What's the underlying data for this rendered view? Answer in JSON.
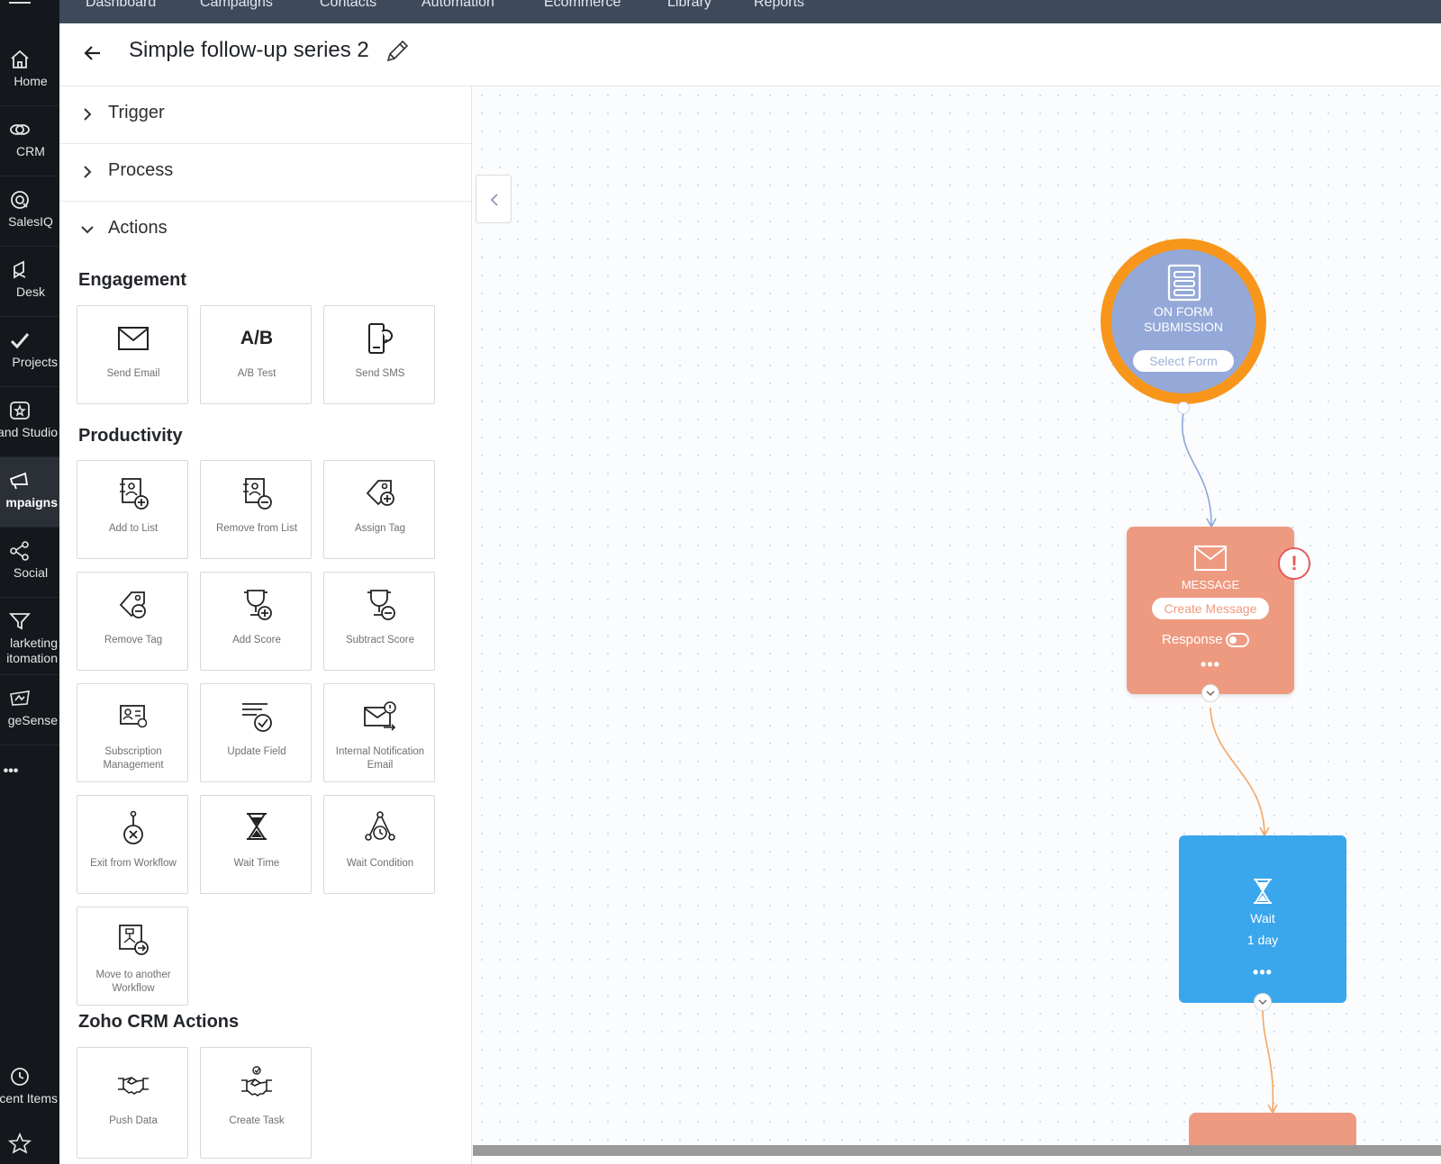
{
  "top_nav": {
    "items": [
      "Dashboard",
      "Campaigns",
      "Contacts",
      "Automation",
      "Ecommerce",
      "Library",
      "Reports"
    ]
  },
  "rail": {
    "items": [
      {
        "label": "Home",
        "icon": "home-icon"
      },
      {
        "label": "CRM",
        "icon": "crm-icon"
      },
      {
        "label": "SalesIQ",
        "icon": "salesiq-icon"
      },
      {
        "label": "Desk",
        "icon": "desk-icon"
      },
      {
        "label": "Projects",
        "icon": "check-icon"
      },
      {
        "label": "and Studio",
        "icon": "brand-studio-icon"
      },
      {
        "label": "mpaigns",
        "icon": "megaphone-icon"
      },
      {
        "label": "Social",
        "icon": "share-icon"
      },
      {
        "label": "larketing\nitomation",
        "icon": "funnel-icon"
      },
      {
        "label": "geSense",
        "icon": "pagesense-icon"
      },
      {
        "label": "•••",
        "icon": "more-icon"
      }
    ],
    "bottom": [
      {
        "label": "cent Items",
        "icon": "history-icon"
      },
      {
        "label": "",
        "icon": "star-icon"
      }
    ]
  },
  "header": {
    "title": "Simple follow-up series 2"
  },
  "panel": {
    "accordions": [
      "Trigger",
      "Process",
      "Actions"
    ],
    "sections": {
      "engagement": {
        "title": "Engagement",
        "tiles": [
          {
            "label": "Send Email",
            "icon": "envelope-icon"
          },
          {
            "label": "A/B Test",
            "icon": "ab-test-icon",
            "glyph": "A/B"
          },
          {
            "label": "Send SMS",
            "icon": "sms-icon"
          }
        ]
      },
      "productivity": {
        "title": "Productivity",
        "tiles": [
          {
            "label": "Add to List",
            "icon": "add-to-list-icon"
          },
          {
            "label": "Remove from List",
            "icon": "remove-from-list-icon"
          },
          {
            "label": "Assign Tag",
            "icon": "assign-tag-icon"
          },
          {
            "label": "Remove Tag",
            "icon": "remove-tag-icon"
          },
          {
            "label": "Add Score",
            "icon": "add-score-icon"
          },
          {
            "label": "Subtract Score",
            "icon": "subtract-score-icon"
          },
          {
            "label": "Subscription Management",
            "icon": "subscription-icon"
          },
          {
            "label": "Update Field",
            "icon": "update-field-icon"
          },
          {
            "label": "Internal Notification Email",
            "icon": "notification-email-icon"
          },
          {
            "label": "Exit from Workflow",
            "icon": "exit-workflow-icon"
          },
          {
            "label": "Wait Time",
            "icon": "hourglass-icon"
          },
          {
            "label": "Wait Condition",
            "icon": "wait-condition-icon"
          },
          {
            "label": "Move to another Workflow",
            "icon": "move-workflow-icon"
          }
        ]
      },
      "crm": {
        "title": "Zoho CRM Actions",
        "tiles": [
          {
            "label": "Push Data",
            "icon": "handshake-icon"
          },
          {
            "label": "Create Task",
            "icon": "create-task-icon"
          }
        ]
      }
    }
  },
  "canvas": {
    "trigger": {
      "line1": "ON FORM",
      "line2": "SUBMISSION",
      "button": "Select Form"
    },
    "message": {
      "label": "MESSAGE",
      "button": "Create Message",
      "response_label": "Response",
      "more": "•••",
      "warning": "!"
    },
    "wait": {
      "label": "Wait",
      "duration": "1 day",
      "more": "•••"
    }
  },
  "colors": {
    "trigger_ring": "#f7961b",
    "trigger_fill": "#95a9d8",
    "message_fill": "#ee9a80",
    "wait_fill": "#3aa6ec",
    "connector_blue": "#8aa7d9",
    "connector_orange": "#f2a766"
  }
}
